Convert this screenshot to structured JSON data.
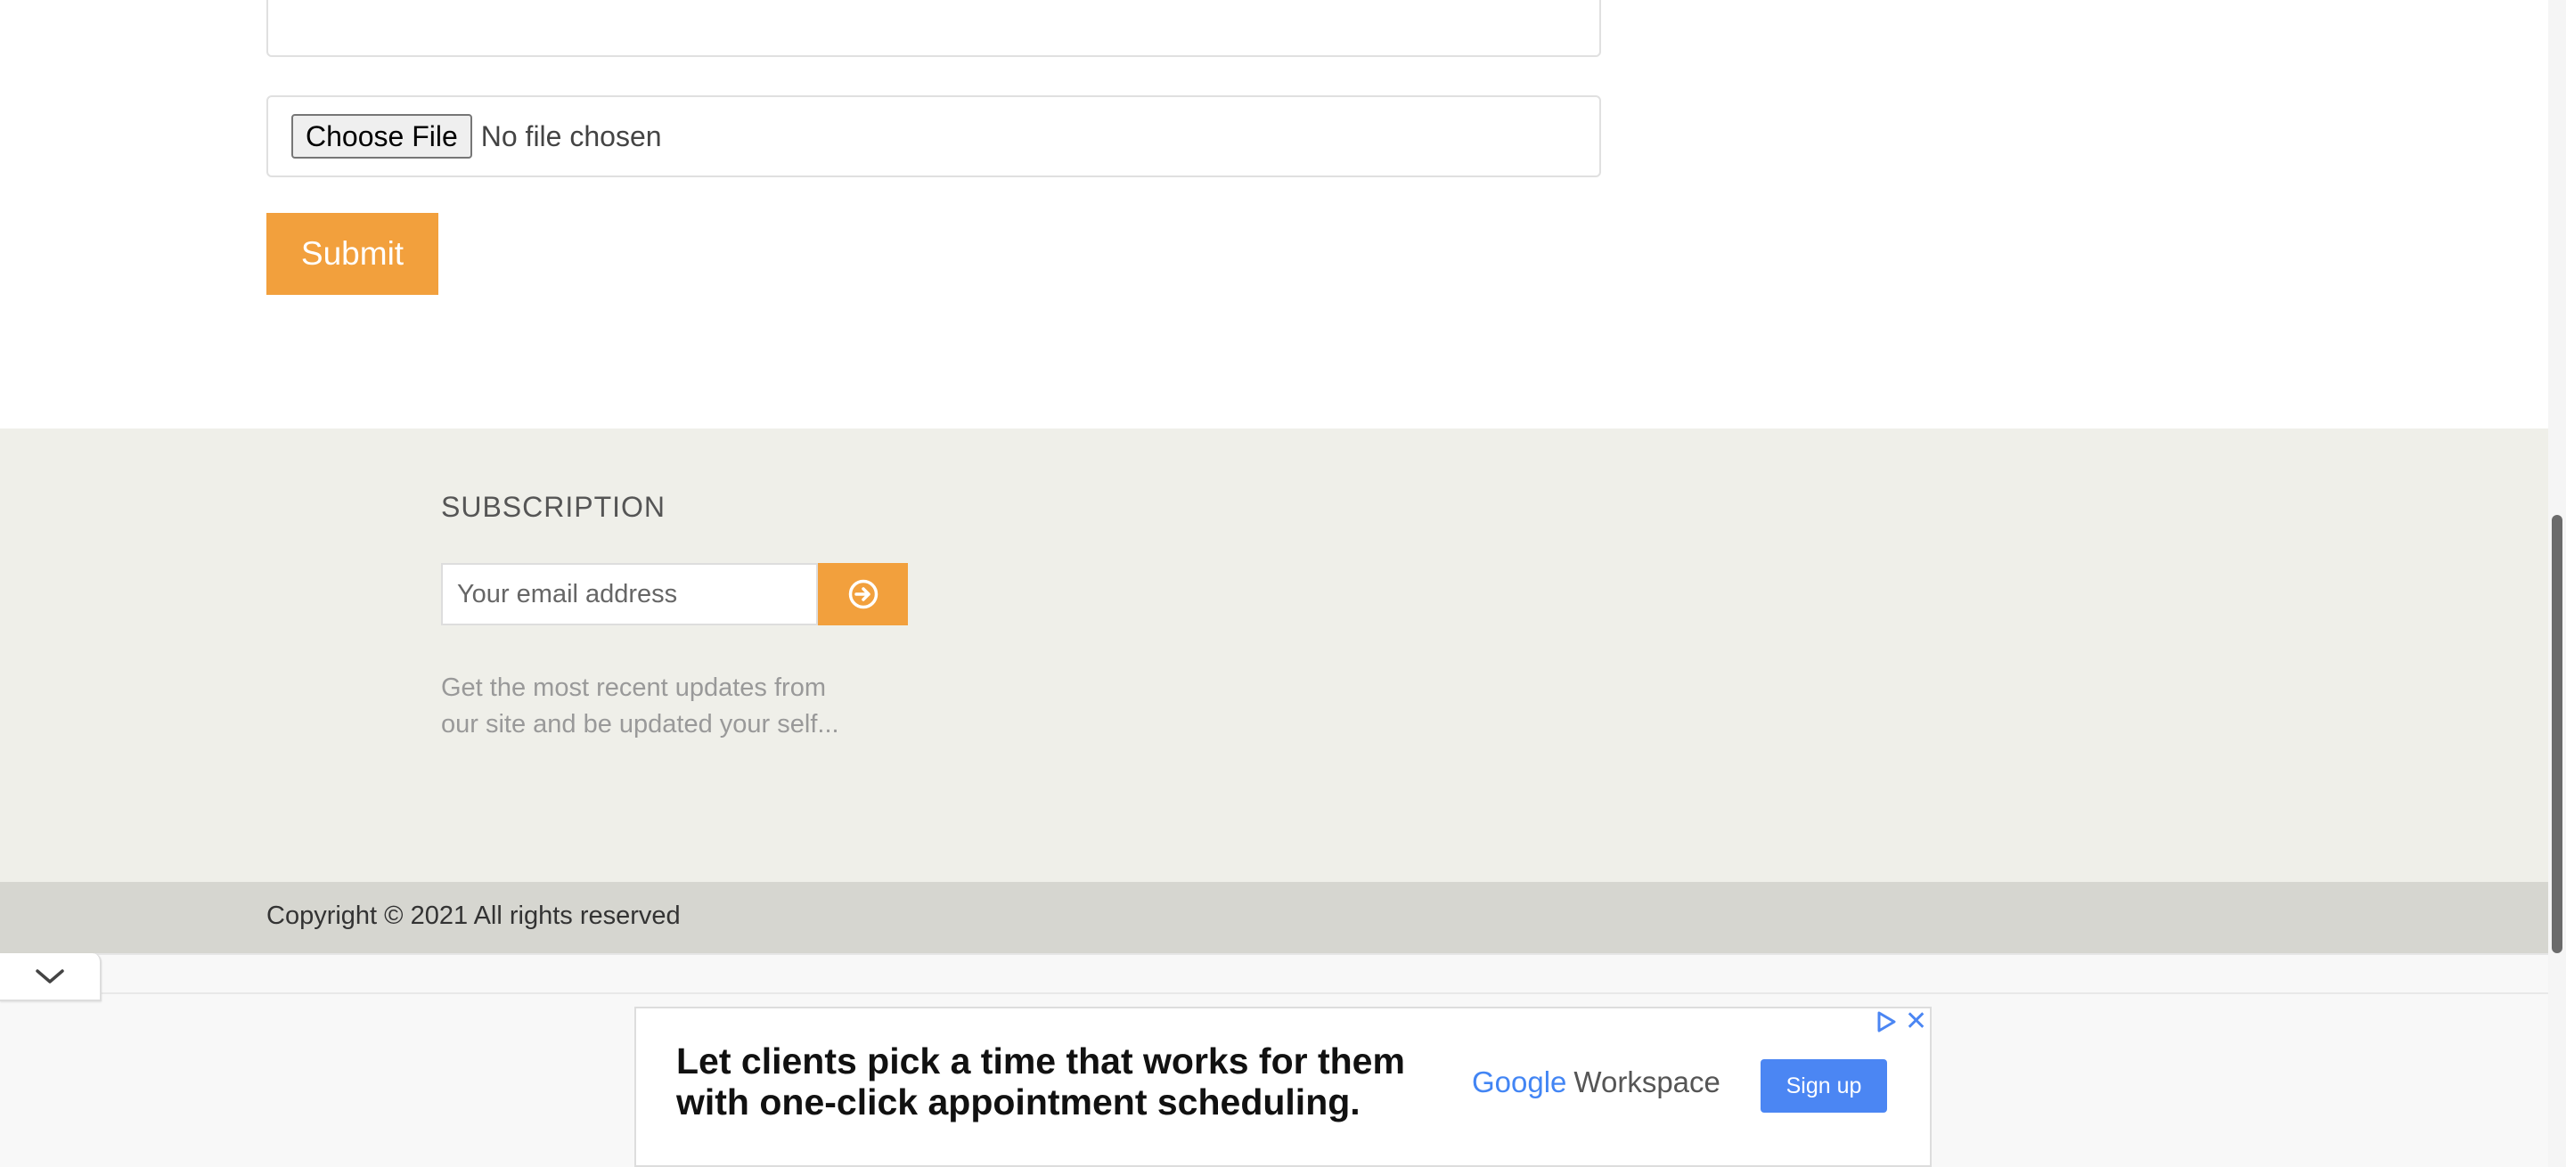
{
  "form": {
    "file_button_label": "Choose File",
    "file_status": "No file chosen",
    "submit_label": "Submit"
  },
  "footer": {
    "subscription_title": "SUBSCRIPTION",
    "email_placeholder": "Your email address",
    "description_line1": "Get the most recent updates from",
    "description_line2": "our site and be updated your self...",
    "copyright": "Copyright © 2021 All rights reserved"
  },
  "ad": {
    "headline_line1": "Let clients pick a time that works for them",
    "headline_line2": "with one-click appointment scheduling.",
    "brand_google": "Google",
    "brand_product": "Workspace",
    "cta_label": "Sign up"
  },
  "colors": {
    "accent": "#f2a03d",
    "footer_bg": "#efefe9",
    "footer_bottom_bg": "#d6d6d0",
    "ad_cta": "#4b86f3"
  },
  "icons": {
    "subscribe": "arrow-circle-right-icon",
    "collapse": "chevron-down-icon",
    "ad_choices": "ad-choices-icon",
    "ad_close": "close-icon"
  }
}
